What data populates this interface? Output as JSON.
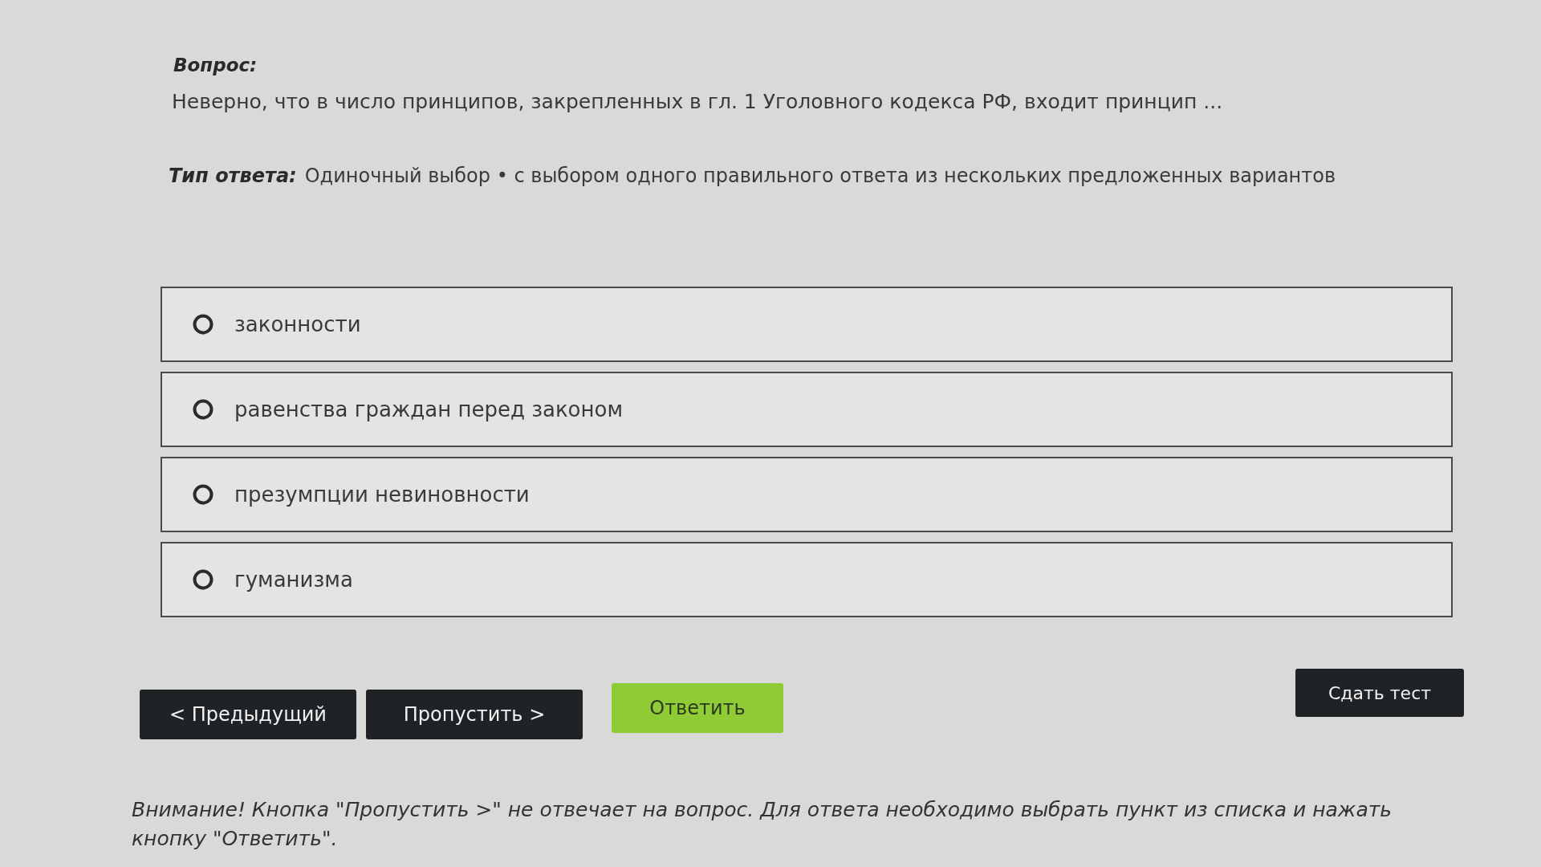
{
  "question": {
    "label": "Вопрос:",
    "text": "Неверно, что в число принципов, закрепленных в гл. 1 Уголовного кодекса РФ, входит принцип ..."
  },
  "answer_type": {
    "label": "Тип ответа:",
    "text": "Одиночный выбор • с выбором одного правильного ответа из нескольких предложенных вариантов"
  },
  "options": [
    {
      "label": "законности",
      "selected": false
    },
    {
      "label": "равенства граждан перед законом",
      "selected": false
    },
    {
      "label": "презумпции невиновности",
      "selected": false
    },
    {
      "label": "гуманизма",
      "selected": false
    }
  ],
  "buttons": [
    {
      "label": "< Предыдущий",
      "kind": "dark"
    },
    {
      "label": "Пропустить >",
      "kind": "dark"
    },
    {
      "label": "Ответить",
      "kind": "primary"
    }
  ],
  "submit_button": {
    "label": "Сдать тест"
  },
  "notice": "Внимание! Кнопка \"Пропустить >\" не отвечает на вопрос. Для ответа необходимо выбрать пункт из списка и нажать кнопку \"Ответить\"."
}
